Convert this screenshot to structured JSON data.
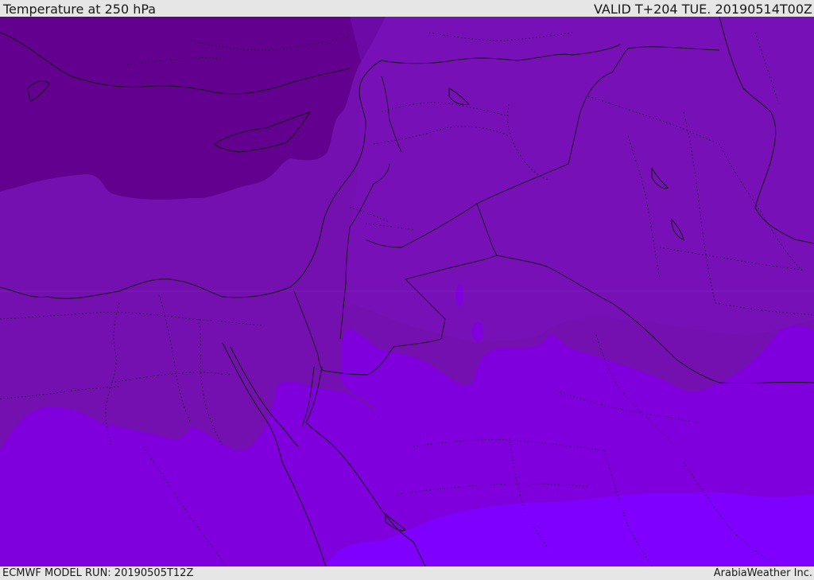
{
  "header": {
    "title": "Temperature at 250 hPa",
    "valid": "VALID T+204 TUE. 20190514T00Z"
  },
  "footer": {
    "model_run": "ECMWF MODEL RUN: 20190505T12Z",
    "credit": "ArabiaWeather Inc."
  },
  "map": {
    "field": "temperature",
    "level": "250 hPa",
    "colors": {
      "band_coldest": "#630090",
      "band_cold": "#7510b0",
      "band_mid": "#7a14c2",
      "band_warm": "#7f00dc",
      "band_warmest": "#7f00ff",
      "coastline": "#111111",
      "borders": "#111111"
    }
  }
}
